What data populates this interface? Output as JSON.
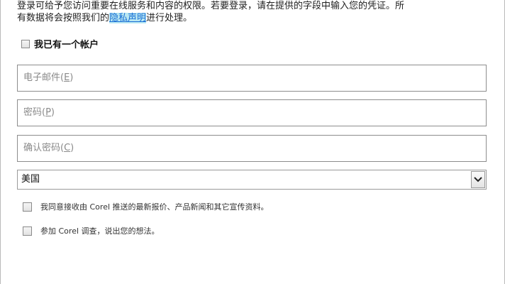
{
  "intro": {
    "line1": "登录可给予您访问重要在线服务和内容的权限。若要登录，请在提供的字段中输入您的凭证。所",
    "line2_before": "有数据将会按照我们的",
    "privacy_link": "隐私声明",
    "line2_after": "进行处理。"
  },
  "have_account": {
    "label": "我已有一个帐户"
  },
  "fields": {
    "email": {
      "label": "电子邮件(",
      "key": "E",
      "end": ")"
    },
    "password": {
      "label": "密码(",
      "key": "P",
      "end": ")"
    },
    "confirm_password": {
      "label": "确认密码(",
      "key": "C",
      "end": ")"
    }
  },
  "country": {
    "selected": "美国"
  },
  "options": {
    "offers_label": "我同意接收由 Corel 推送的最新报价、产品新闻和其它宣传资料。",
    "survey_label": "参加 Corel 调查，说出您的想法。"
  },
  "icons": {
    "dropdown": "chevron-down-icon"
  }
}
